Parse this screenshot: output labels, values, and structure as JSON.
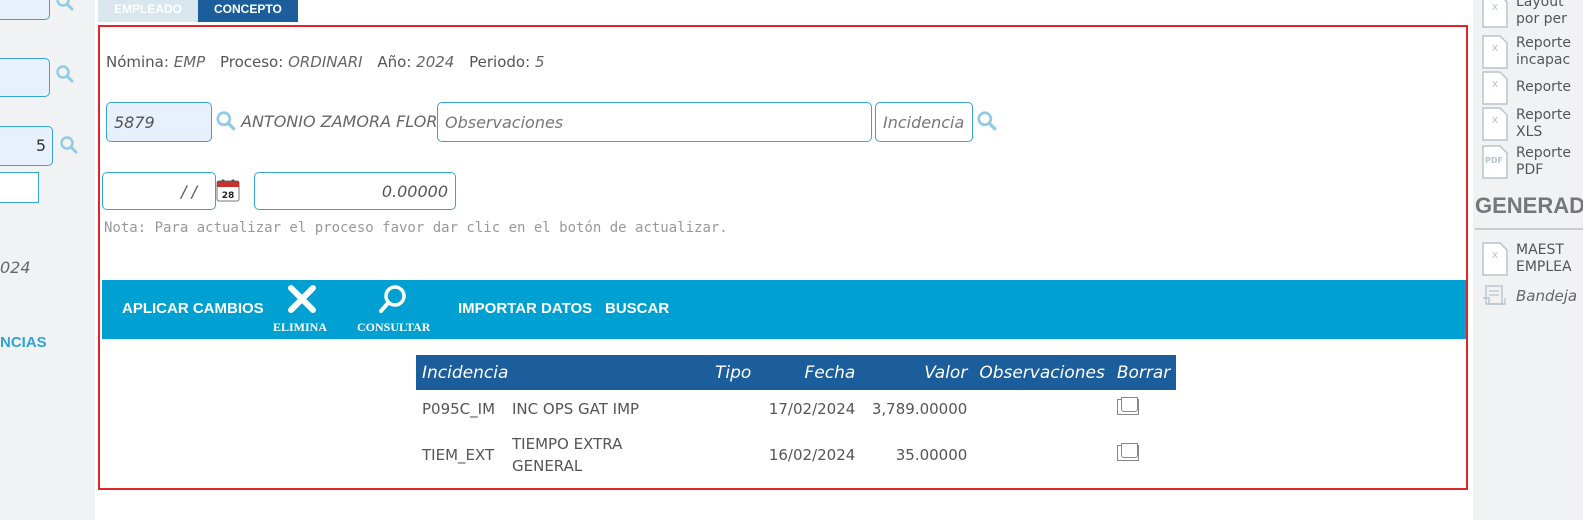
{
  "left_panel": {
    "field_5_value": "5",
    "year_fragment": "024",
    "link_fragment": "NCIAS"
  },
  "tabs": [
    {
      "label": "EMPLEADO"
    },
    {
      "label": "CONCEPTO"
    }
  ],
  "info": {
    "nomina_label": "Nómina:",
    "nomina_value": "EMP",
    "proceso_label": "Proceso:",
    "proceso_value": "ORDINARI",
    "anio_label": "Año:",
    "anio_value": "2024",
    "periodo_label": "Periodo:",
    "periodo_value": "5"
  },
  "form": {
    "employee_id": "5879",
    "employee_name": "ANTONIO ZAMORA FLORES",
    "observaciones_placeholder": "Observaciones",
    "incidencia_placeholder": "Incidencia",
    "date_value": "/ /",
    "amount_value": "0.00000",
    "calendar_day": "28",
    "nota": "Nota: Para actualizar el proceso favor dar clic en el botón de actualizar."
  },
  "toolbar": {
    "aplicar_cambios": "APLICAR CAMBIOS",
    "elimina": "ELIMINA",
    "consultar": "CONSULTAR",
    "importar_datos": "IMPORTAR DATOS",
    "buscar": "BUSCAR"
  },
  "table": {
    "headers": [
      "Incidencia",
      "Tipo",
      "Fecha",
      "Valor",
      "Observaciones",
      "Borrar"
    ],
    "rows": [
      {
        "code": "P095C_IM",
        "desc": "INC OPS GAT IMP",
        "tipo": "",
        "fecha": "17/02/2024",
        "valor": "3,789.00000",
        "obs": ""
      },
      {
        "code": "TIEM_EXT",
        "desc": "TIEMPO EXTRA GENERAL",
        "tipo": "",
        "fecha": "16/02/2024",
        "valor": "35.00000",
        "obs": ""
      }
    ]
  },
  "right_panel": {
    "items": [
      {
        "label1": "Layout",
        "label2": "por per"
      },
      {
        "label1": "Reporte",
        "label2": "incapac"
      },
      {
        "label1": "Reporte",
        "label2": ""
      },
      {
        "label1": "Reporte",
        "label2": "XLS"
      },
      {
        "label1": "Reporte",
        "label2": "PDF"
      }
    ],
    "heading": "GENERAD",
    "maest_1": "MAEST",
    "maest_2": "EMPLEA",
    "bandeja": "Bandeja"
  }
}
